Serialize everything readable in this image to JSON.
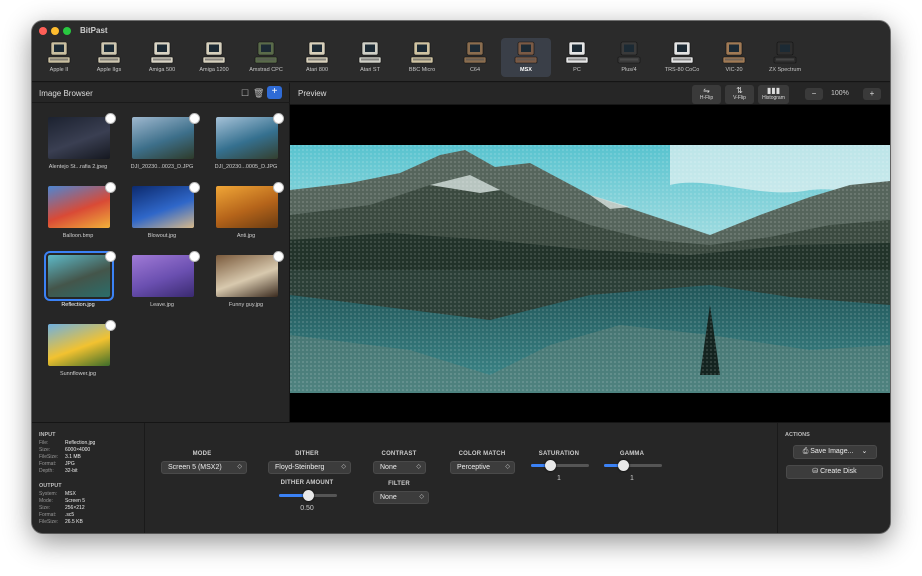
{
  "app": {
    "title": "BitPast"
  },
  "systems": [
    {
      "label": "Apple II",
      "color": "#c9bfa0",
      "icon": "computer-icon"
    },
    {
      "label": "Apple IIgs",
      "color": "#cdc6b0",
      "icon": "computer-icon"
    },
    {
      "label": "Amiga 500",
      "color": "#d9d4c5",
      "icon": "computer-icon"
    },
    {
      "label": "Amiga 1200",
      "color": "#d6d0bd",
      "icon": "computer-icon"
    },
    {
      "label": "Amstrad CPC",
      "color": "#5a6b4a",
      "icon": "computer-icon"
    },
    {
      "label": "Atari 800",
      "color": "#d8d0bb",
      "icon": "computer-icon"
    },
    {
      "label": "Atari ST",
      "color": "#cfcfc6",
      "icon": "computer-icon"
    },
    {
      "label": "BBC Micro",
      "color": "#cfc3a2",
      "icon": "computer-icon"
    },
    {
      "label": "C64",
      "color": "#8a6d4f",
      "icon": "computer-icon"
    },
    {
      "label": "MSX",
      "color": "#7a5a45",
      "icon": "computer-icon"
    },
    {
      "label": "PC",
      "color": "#e6e6e6",
      "icon": "computer-icon"
    },
    {
      "label": "Plus/4",
      "color": "#3a3a3a",
      "icon": "computer-icon"
    },
    {
      "label": "TRS-80 CoCo",
      "color": "#e3e3e3",
      "icon": "computer-icon"
    },
    {
      "label": "VIC-20",
      "color": "#a07a55",
      "icon": "computer-icon"
    },
    {
      "label": "ZX Spectrum",
      "color": "#2e2e2e",
      "icon": "computer-icon"
    }
  ],
  "selected_system": "MSX",
  "image_browser": {
    "title": "Image Browser",
    "items": [
      {
        "name": "Alentejo St...rafia 2.jpeg",
        "colors": [
          "#1c2230",
          "#3a3f52",
          "#151820"
        ]
      },
      {
        "name": "DJI_20230...0023_D.JPG",
        "colors": [
          "#9fb8cf",
          "#3d6f8a",
          "#2e3b2a"
        ]
      },
      {
        "name": "DJI_20230...0005_D.JPG",
        "colors": [
          "#a6c2d8",
          "#35708f",
          "#343f2e"
        ]
      },
      {
        "name": "Balloon.bmp",
        "colors": [
          "#4d86d2",
          "#d94a36",
          "#f0b13a"
        ]
      },
      {
        "name": "Blowout.jpg",
        "colors": [
          "#0c2a6e",
          "#2f67c9",
          "#d7b98a"
        ]
      },
      {
        "name": "Anti.jpg",
        "colors": [
          "#f0a637",
          "#b5641a",
          "#6b3c12"
        ]
      },
      {
        "name": "Reflection.jpg",
        "colors": [
          "#5db9c8",
          "#44554a",
          "#2a6d6a"
        ]
      },
      {
        "name": "Leave.jpg",
        "colors": [
          "#a07ad6",
          "#6a4fb0",
          "#3a2a70"
        ]
      },
      {
        "name": "Funny guy.jpg",
        "colors": [
          "#7a5a3c",
          "#d8c9ae",
          "#3a2a1e"
        ]
      },
      {
        "name": "Sunnflower.jpg",
        "colors": [
          "#6fb0e0",
          "#f2c230",
          "#3d6d2a"
        ]
      }
    ],
    "selected": "Reflection.jpg"
  },
  "preview": {
    "title": "Preview",
    "hflip": "H-Flip",
    "vflip": "V-Flip",
    "histogram": "Histogram",
    "zoom": "100%"
  },
  "input": {
    "heading": "INPUT",
    "rows": [
      {
        "k": "File:",
        "v": "Reflection.jpg"
      },
      {
        "k": "Size:",
        "v": "6000×4000"
      },
      {
        "k": "FileSize:",
        "v": "3.1 MB"
      },
      {
        "k": "Format:",
        "v": "JPG"
      },
      {
        "k": "Depth:",
        "v": "32-bit"
      }
    ]
  },
  "output": {
    "heading": "OUTPUT",
    "rows": [
      {
        "k": "System:",
        "v": "MSX"
      },
      {
        "k": "Mode:",
        "v": "Screen 5"
      },
      {
        "k": "Size:",
        "v": "256×212"
      },
      {
        "k": "Format:",
        "v": ".sc5"
      },
      {
        "k": "FileSize:",
        "v": "26.5 KB"
      }
    ]
  },
  "controls": {
    "mode": {
      "label": "MODE",
      "value": "Screen 5 (MSX2)"
    },
    "dither": {
      "label": "DITHER",
      "value": "Floyd-Steinberg"
    },
    "dither_amount": {
      "label": "DITHER AMOUNT",
      "value": "0.50",
      "level": 0.5
    },
    "contrast": {
      "label": "CONTRAST",
      "value": "None"
    },
    "filter": {
      "label": "FILTER",
      "value": "None"
    },
    "color_match": {
      "label": "COLOR MATCH",
      "value": "Perceptive"
    },
    "saturation": {
      "label": "SATURATION",
      "value": "1",
      "level": 0.33
    },
    "gamma": {
      "label": "GAMMA",
      "value": "1",
      "level": 0.33
    }
  },
  "actions": {
    "heading": "ACTIONS",
    "save": "Save Image...",
    "create_disk": "Create Disk"
  }
}
